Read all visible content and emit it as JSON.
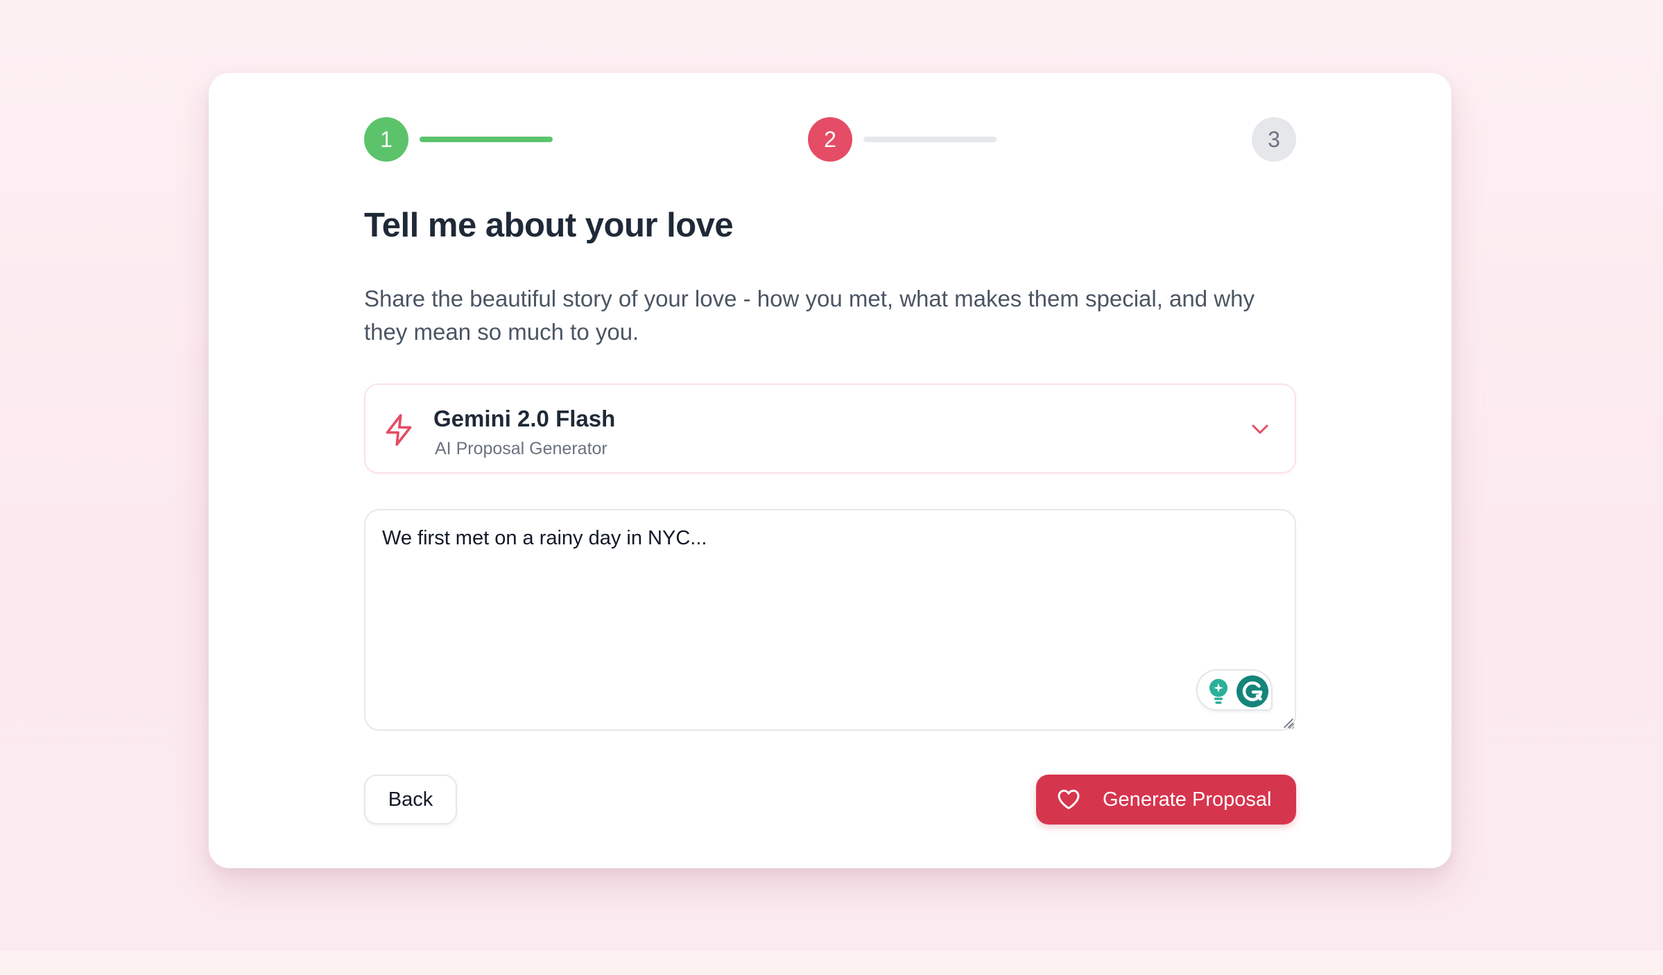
{
  "stepper": {
    "steps": [
      {
        "number": "1",
        "state": "completed",
        "color": "#5cc36b"
      },
      {
        "number": "2",
        "state": "active",
        "color": "#e44d65"
      },
      {
        "number": "3",
        "state": "upcoming",
        "color": "#e5e7eb"
      }
    ]
  },
  "page": {
    "title": "Tell me about your love",
    "description": "Share the beautiful story of your love - how you met, what makes them special, and why they mean so much to you."
  },
  "model_selector": {
    "name": "Gemini 2.0 Flash",
    "subtitle": "AI Proposal Generator",
    "icon": "lightning-bolt-icon",
    "accent_color": "#e44d65"
  },
  "story": {
    "value": "We first met on a rainy day in NYC..."
  },
  "grammarly_widget": {
    "icons": [
      "lightbulb-icon",
      "grammarly-g-icon"
    ],
    "color": "#15847a"
  },
  "actions": {
    "back_label": "Back",
    "generate_label": "Generate Proposal",
    "generate_icon": "heart-icon",
    "generate_color": "#d6354e"
  }
}
